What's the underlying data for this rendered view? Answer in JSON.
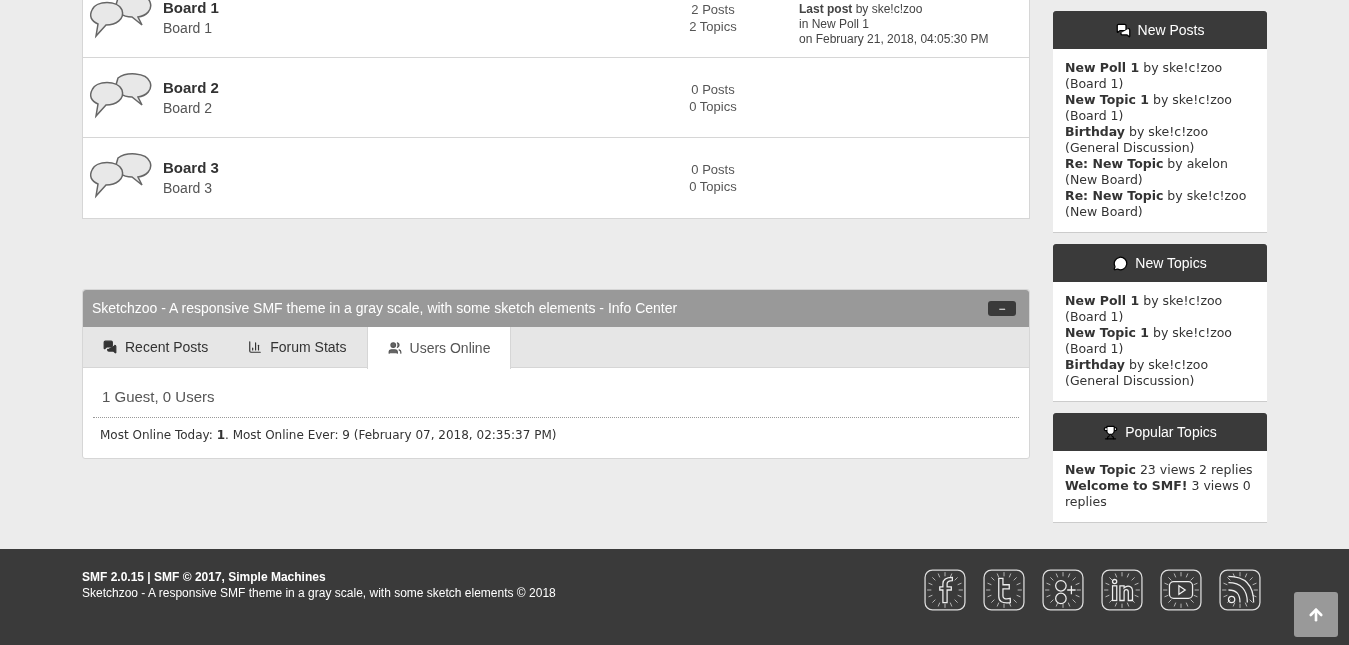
{
  "boards": [
    {
      "title": "Board 1",
      "description": "Board 1",
      "posts": "2 Posts",
      "topics": "2 Topics",
      "last_post": [
        "**Last post** by ske!c!zoo",
        "in New Poll 1",
        "on February 21, 2018, 04:05:30 PM"
      ]
    },
    {
      "title": "Board 2",
      "description": "Board 2",
      "posts": "0 Posts",
      "topics": "0 Topics"
    },
    {
      "title": "Board 3",
      "description": "Board 3",
      "posts": "0 Posts",
      "topics": "0 Topics"
    }
  ],
  "info_center": {
    "title": "Sketchzoo - A responsive SMF theme in a gray scale, with some sketch elements - Info Center",
    "collapse": "−",
    "tabs": [
      {
        "label": "Recent Posts",
        "kind": "posts",
        "selected": false
      },
      {
        "label": "Forum Stats",
        "kind": "stats",
        "selected": false
      },
      {
        "label": "Users Online",
        "kind": "users",
        "selected": true
      }
    ],
    "users": "1 Guest, 0 Users",
    "most_online": "Most Online Today: **1**. Most Online Ever: 9 (February 07, 2018, 02:35:37 PM)"
  },
  "sidebar": [
    {
      "title": "New Posts",
      "kind": "comments",
      "items": [
        "**New Poll 1** by ske!c!zoo (Board 1)",
        "**New Topic 1** by ske!c!zoo (Board 1)",
        "**Birthday** by ske!c!zoo (General Discussion)",
        "**Re: New Topic** by akelon (New Board)",
        "**Re: New Topic** by ske!c!zoo (New Board)"
      ]
    },
    {
      "title": "New Topics",
      "kind": "comment",
      "items": [
        "**New Poll 1** by ske!c!zoo (Board 1)",
        "**New Topic 1** by ske!c!zoo (Board 1)",
        "**Birthday** by ske!c!zoo (General Discussion)"
      ]
    },
    {
      "title": "Popular Topics",
      "kind": "trophy",
      "items": [
        "**New Topic** 23 views 2 replies",
        "**Welcome to SMF!** 3 views 0 replies"
      ]
    }
  ],
  "footer": {
    "line1": "SMF 2.0.15 | SMF © 2017, Simple Machines",
    "line2": "Sketchzoo - A responsive SMF theme in a gray scale, with some sketch elements © 2018",
    "social": [
      {
        "kind": "f"
      },
      {
        "kind": "t"
      },
      {
        "kind": "g"
      },
      {
        "kind": "in"
      },
      {
        "kind": "video"
      },
      {
        "kind": "rss"
      }
    ]
  }
}
